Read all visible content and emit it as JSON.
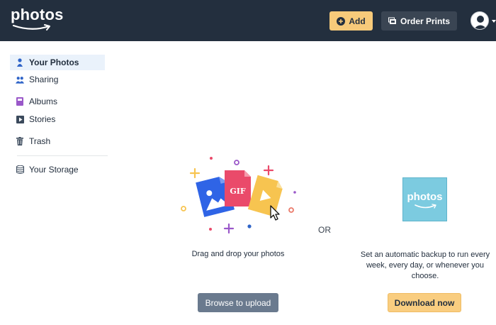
{
  "header": {
    "logo_text": "photos",
    "add_label": "Add",
    "order_prints_label": "Order Prints"
  },
  "sidebar": {
    "items": [
      {
        "label": "Your Photos",
        "icon": "person-icon",
        "active": true
      },
      {
        "label": "Sharing",
        "icon": "people-icon"
      },
      {
        "label": "Albums",
        "icon": "album-icon"
      },
      {
        "label": "Stories",
        "icon": "play-icon"
      },
      {
        "label": "Trash",
        "icon": "trash-icon"
      },
      {
        "label": "Your Storage",
        "icon": "storage-icon"
      }
    ]
  },
  "main": {
    "illustration_gif_label": "GIF",
    "drag_text": "Drag and drop your photos",
    "browse_label": "Browse to upload",
    "or_text": "OR",
    "app_tile_text": "photos",
    "backup_text": "Set an automatic backup to run every week, every day, or whenever you choose.",
    "download_label": "Download now"
  },
  "colors": {
    "header_bg": "#232f3e",
    "accent": "#f7ca7a",
    "active_nav_bg": "#eaf2fb",
    "browse_button": "#6a7a8e",
    "app_tile": "#7ccbe0"
  }
}
